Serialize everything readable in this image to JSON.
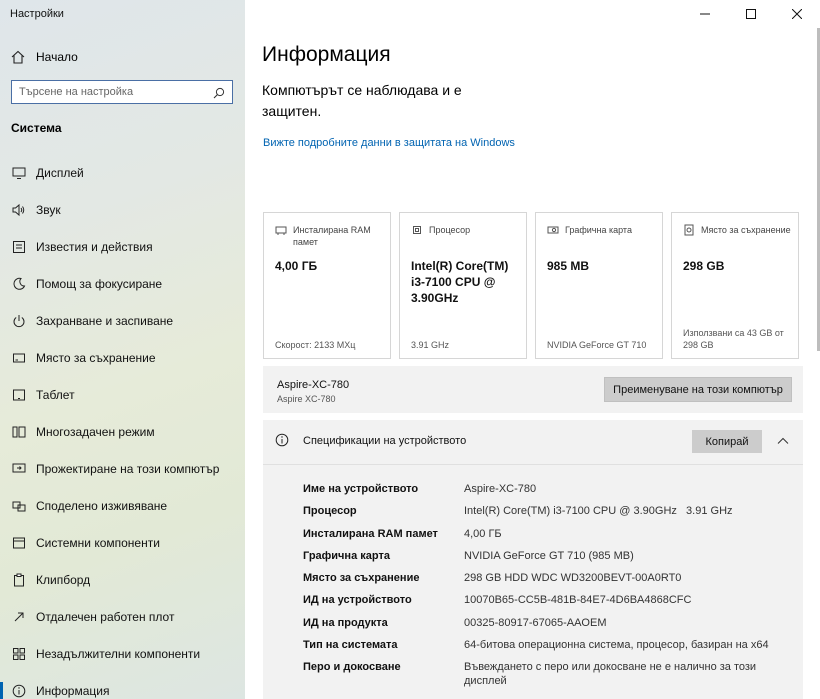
{
  "app": {
    "title": "Настройки"
  },
  "sidebar": {
    "home_label": "Начало",
    "search_placeholder": "Търсене на настройка",
    "section_title": "Система",
    "items": [
      {
        "label": "Дисплей",
        "icon": "display-icon"
      },
      {
        "label": "Звук",
        "icon": "sound-icon"
      },
      {
        "label": "Известия и действия",
        "icon": "notifications-icon"
      },
      {
        "label": "Помощ за фокусиране",
        "icon": "focus-assist-icon"
      },
      {
        "label": "Захранване и заспиване",
        "icon": "power-icon"
      },
      {
        "label": "Място за съхранение",
        "icon": "storage-icon"
      },
      {
        "label": "Таблет",
        "icon": "tablet-icon"
      },
      {
        "label": "Многозадачен режим",
        "icon": "multitasking-icon"
      },
      {
        "label": "Прожектиране на този компютър",
        "icon": "projecting-icon"
      },
      {
        "label": "Споделено изживяване",
        "icon": "shared-experiences-icon"
      },
      {
        "label": "Системни компоненти",
        "icon": "system-components-icon"
      },
      {
        "label": "Клипборд",
        "icon": "clipboard-icon"
      },
      {
        "label": "Отдалечен работен плот",
        "icon": "remote-desktop-icon"
      },
      {
        "label": "Незадължителни компоненти",
        "icon": "optional-features-icon"
      },
      {
        "label": "Информация",
        "icon": "about-icon",
        "active": true
      }
    ]
  },
  "main": {
    "title": "Информация",
    "status": "Компютърът се наблюдава и е защитен.",
    "security_link": "Вижте подробните данни в защитата на Windows",
    "cards": [
      {
        "header": "Инсталирана RAM памет",
        "value": "4,00 ГБ",
        "footer": "Скорост: 2133 МХц",
        "icon": "ram-icon"
      },
      {
        "header": "Процесор",
        "value": "Intel(R) Core(TM) i3-7100 CPU @ 3.90GHz",
        "footer": "3.91 GHz",
        "icon": "cpu-icon"
      },
      {
        "header": "Графична карта",
        "value": "985 MB",
        "footer": "NVIDIA GeForce GT 710",
        "icon": "gpu-icon"
      },
      {
        "header": "Място за съхранение",
        "value": "298 GB",
        "footer": "Използвани са 43 GB от 298 GB",
        "icon": "storage-icon"
      }
    ],
    "device": {
      "name": "Aspire-XC-780",
      "model": "Aspire XC-780",
      "rename_button": "Преименуване на този компютър"
    },
    "specs": {
      "title": "Спецификации на устройството",
      "copy_button": "Копирай",
      "rows": [
        {
          "key": "Име на устройството",
          "value": "Aspire-XC-780"
        },
        {
          "key": "Процесор",
          "value": "Intel(R) Core(TM) i3-7100 CPU @ 3.90GHz   3.91 GHz"
        },
        {
          "key": "Инсталирана RAM памет",
          "value": "4,00 ГБ"
        },
        {
          "key": "Графична карта",
          "value": "NVIDIA GeForce GT 710 (985 MB)"
        },
        {
          "key": "Място за съхранение",
          "value": "298 GB HDD WDC WD3200BEVT-00A0RT0"
        },
        {
          "key": "ИД на устройството",
          "value": "10070B65-CC5B-481B-84E7-4D6BA4868CFC"
        },
        {
          "key": "ИД на продукта",
          "value": "00325-80917-67065-AAOEM"
        },
        {
          "key": "Тип на системата",
          "value": "64-битова операционна система, процесор, базиран на x64"
        },
        {
          "key": "Перо и докосване",
          "value": "Въвеждането с перо или докосване не е налично за този дисплей"
        }
      ]
    }
  }
}
